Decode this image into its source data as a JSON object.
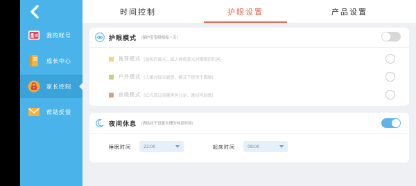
{
  "sidebar": {
    "items": [
      {
        "label": "我的帐号",
        "icon": "account-card-icon",
        "active": false
      },
      {
        "label": "成长中心",
        "icon": "notebook-icon",
        "active": false
      },
      {
        "label": "家长控制",
        "icon": "lock-icon",
        "active": true
      },
      {
        "label": "帮助反馈",
        "icon": "mail-icon",
        "active": false
      }
    ],
    "back_icon": "chevron-left-icon"
  },
  "tabs": [
    {
      "label": "时间控制",
      "active": false
    },
    {
      "label": "护眼设置",
      "active": true
    },
    {
      "label": "产品设置",
      "active": false
    }
  ],
  "eye_care": {
    "title": "护眼模式",
    "subtitle": "(保护宝宝眼睛每一天)",
    "icon": "eye-icon",
    "enabled": false,
    "options": [
      {
        "label": "推荐模式",
        "desc": "(温和的黄光，减少屏幕蓝光对眼睛的伤害)",
        "color": "#f0d58a",
        "selected": false
      },
      {
        "label": "户外模式",
        "desc": "(人眼对绿光敏感，模式下使用不费眼)",
        "color": "#b9d488",
        "selected": false
      },
      {
        "label": "夜晚模式",
        "desc": "(红光透过视膜黑色分泌，晚间可助眠)",
        "color": "#e29a85",
        "selected": false
      }
    ]
  },
  "night_rest": {
    "title": "夜间休息",
    "subtitle": "(请给孩子设置合理的休息时间)",
    "icon": "moon-icon",
    "enabled": true,
    "sleep_label": "睡眠时间",
    "sleep_value": "22:00",
    "wake_label": "起床时间",
    "wake_value": "08:00"
  },
  "colors": {
    "sidebar": "#4ab4ea",
    "accent": "#e06a50",
    "toggle_on": "#5fb2ec"
  }
}
